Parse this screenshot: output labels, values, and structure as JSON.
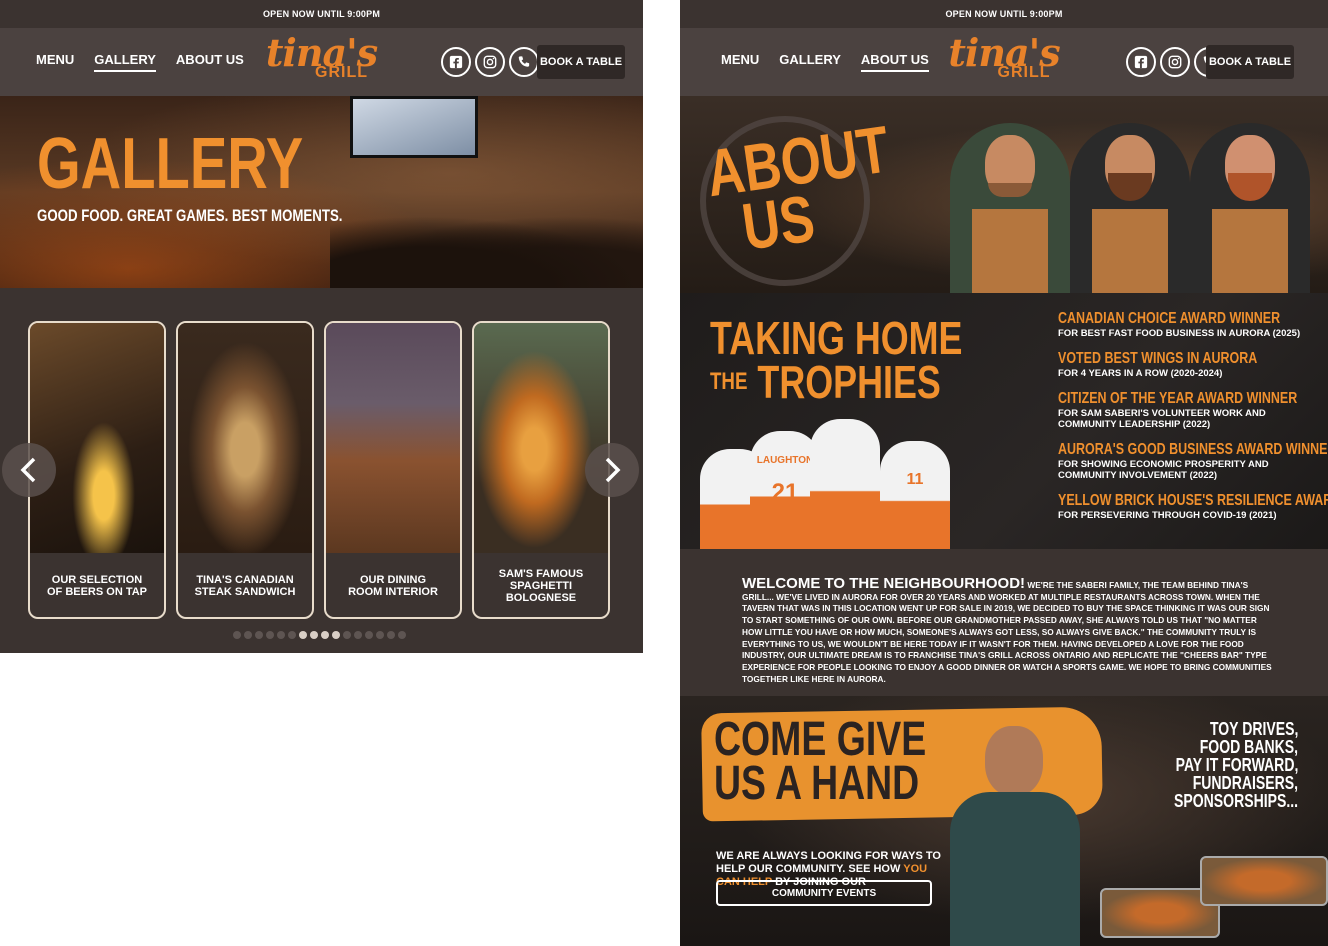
{
  "gallery_page": {
    "topbar": "OPEN NOW UNTIL 9:00PM",
    "nav": [
      {
        "label": "MENU"
      },
      {
        "label": "GALLERY"
      },
      {
        "label": "ABOUT US"
      }
    ],
    "logo": {
      "script": "tina's",
      "sub": "GRILL"
    },
    "book_label": "BOOK A TABLE",
    "hero": {
      "title": "GALLERY",
      "subtitle": "GOOD FOOD. GREAT GAMES. BEST MOMENTS."
    },
    "cards": [
      {
        "label": "OUR SELECTION\nOF BEERS ON TAP"
      },
      {
        "label": "TINA'S CANADIAN\nSTEAK SANDWICH"
      },
      {
        "label": "OUR DINING\nROOM INTERIOR"
      },
      {
        "label": "SAM'S FAMOUS\nSPAGHETTI BOLOGNESE"
      }
    ]
  },
  "about_page": {
    "topbar": "OPEN NOW UNTIL 9:00PM",
    "nav": [
      {
        "label": "MENU"
      },
      {
        "label": "GALLERY"
      },
      {
        "label": "ABOUT US"
      }
    ],
    "logo": {
      "script": "tina's",
      "sub": "GRILL"
    },
    "book_label": "BOOK A TABLE",
    "hero_title": {
      "line1": "ABOUT",
      "line2": "US"
    },
    "trophies": {
      "title_line1": "TAKING HOME",
      "title_the": "THE",
      "title_line2": "TROPHIES",
      "awards": [
        {
          "name": "CANADIAN CHOICE AWARD WINNER",
          "desc": "FOR BEST FAST FOOD BUSINESS IN AURORA (2025)"
        },
        {
          "name": "VOTED BEST WINGS IN AURORA",
          "desc": "FOR 4 YEARS IN A ROW (2020-2024)"
        },
        {
          "name": "CITIZEN OF THE YEAR AWARD WINNER",
          "desc": "FOR SAM SABERI'S VOLUNTEER WORK AND COMMUNITY LEADERSHIP (2022)"
        },
        {
          "name": "AURORA'S GOOD BUSINESS AWARD WINNER",
          "desc": "FOR SHOWING ECONOMIC PROSPERITY AND COMMUNITY INVOLVEMENT (2022)"
        },
        {
          "name": "YELLOW BRICK HOUSE'S RESILIENCE AWARD",
          "desc": "FOR PERSEVERING THROUGH COVID-19 (2021)"
        }
      ],
      "player_numbers": [
        "21",
        "11"
      ],
      "player_name": "LAUGHTON"
    },
    "welcome": {
      "heading": "WELCOME TO THE NEIGHBOURHOOD!",
      "body": "WE'RE THE SABERI FAMILY, THE TEAM BEHIND TINA'S GRILL... WE'VE LIVED IN AURORA FOR OVER 20 YEARS AND WORKED AT MULTIPLE RESTAURANTS ACROSS TOWN. WHEN THE TAVERN THAT WAS IN THIS LOCATION WENT UP FOR SALE IN 2019, WE DECIDED TO BUY THE SPACE THINKING IT WAS OUR SIGN TO START SOMETHING OF OUR OWN. BEFORE OUR GRANDMOTHER PASSED AWAY, SHE ALWAYS TOLD US THAT \"NO MATTER HOW LITTLE YOU HAVE OR HOW MUCH, SOMEONE'S ALWAYS GOT LESS, SO ALWAYS GIVE BACK.\" THE COMMUNITY TRULY IS EVERYTHING TO US, WE WOULDN'T BE HERE TODAY IF IT WASN'T FOR THEM. HAVING DEVELOPED A LOVE FOR THE FOOD INDUSTRY, OUR ULTIMATE DREAM IS TO FRANCHISE TINA'S GRILL ACROSS ONTARIO AND REPLICATE THE \"CHEERS BAR\" TYPE EXPERIENCE FOR PEOPLE LOOKING TO ENJOY A GOOD DINNER OR WATCH A SPORTS GAME. WE HOPE TO BRING COMMUNITIES TOGETHER LIKE HERE IN AURORA."
    },
    "give_hand": {
      "title_line1": "COME GIVE",
      "title_line2": "US A HAND",
      "list": [
        "TOY DRIVES,",
        "FOOD BANKS,",
        "PAY IT FORWARD,",
        "FUNDRAISERS,",
        "SPONSORSHIPS..."
      ],
      "text_before": "WE ARE ALWAYS LOOKING FOR WAYS TO HELP OUR COMMUNITY. SEE HOW ",
      "text_link": "YOU CAN HELP",
      "text_after": " BY JOINING OUR",
      "button": "COMMUNITY EVENTS"
    }
  },
  "colors": {
    "accent_orange": "#f0902e",
    "bg_dark": "#3b3330",
    "nav_bg": "#4b4240"
  },
  "icons": [
    "facebook-icon",
    "instagram-icon",
    "phone-icon",
    "chevron-left-icon",
    "chevron-right-icon"
  ]
}
